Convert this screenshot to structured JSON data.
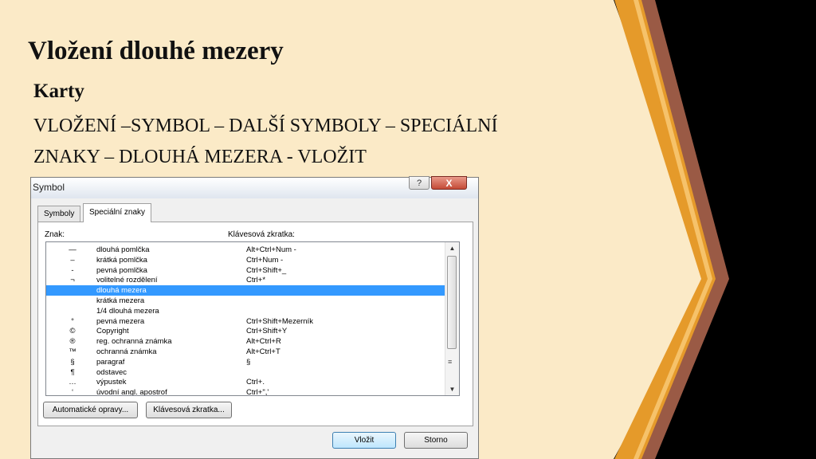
{
  "slide": {
    "title": "Vložení dlouhé mezery",
    "subtitle": "Karty",
    "line1": "VLOŽENÍ –SYMBOL – DALŠÍ SYMBOLY – SPECIÁLNÍ",
    "line2": "ZNAKY – DLOUHÁ MEZERA - VLOŽIT",
    "colors": {
      "background": "#fbeac7",
      "chevron_orange": "#e59a2a",
      "chevron_brown": "#9a5a45",
      "black": "#000000"
    }
  },
  "dialog": {
    "title": "Symbol",
    "help_glyph": "?",
    "close_glyph": "X",
    "tabs": [
      {
        "label": "Symboly"
      },
      {
        "label": "Speciální znaky"
      }
    ],
    "col_char": "Znak:",
    "col_shortcut": "Klávesová zkratka:",
    "rows": [
      {
        "sym": "—",
        "name": "dlouhá pomlčka",
        "key": "Alt+Ctrl+Num -"
      },
      {
        "sym": "–",
        "name": "krátká pomlčka",
        "key": "Ctrl+Num -"
      },
      {
        "sym": "-",
        "name": "pevná pomlčka",
        "key": "Ctrl+Shift+_"
      },
      {
        "sym": "¬",
        "name": "volitelné rozdělení",
        "key": "Ctrl+*"
      },
      {
        "sym": "",
        "name": "dlouhá mezera",
        "key": ""
      },
      {
        "sym": "",
        "name": "krátká mezera",
        "key": ""
      },
      {
        "sym": "",
        "name": "1/4 dlouhá mezera",
        "key": ""
      },
      {
        "sym": "°",
        "name": "pevná mezera",
        "key": "Ctrl+Shift+Mezerník"
      },
      {
        "sym": "©",
        "name": "Copyright",
        "key": "Ctrl+Shift+Y"
      },
      {
        "sym": "®",
        "name": "reg. ochranná známka",
        "key": "Alt+Ctrl+R"
      },
      {
        "sym": "™",
        "name": "ochranná známka",
        "key": "Alt+Ctrl+T"
      },
      {
        "sym": "§",
        "name": "paragraf",
        "key": "§"
      },
      {
        "sym": "¶",
        "name": "odstavec",
        "key": ""
      },
      {
        "sym": "…",
        "name": "výpustek",
        "key": "Ctrl+."
      },
      {
        "sym": "‘",
        "name": "úvodní angl. apostrof",
        "key": "Ctrl+\",'"
      }
    ],
    "selected_row": 4,
    "scroll_up_glyph": "▲",
    "scroll_down_glyph": "▼",
    "scroll_grip": "≡",
    "btn_autocorrect": "Automatické opravy...",
    "btn_shortcut": "Klávesová zkratka...",
    "btn_insert": "Vložit",
    "btn_cancel": "Storno"
  }
}
